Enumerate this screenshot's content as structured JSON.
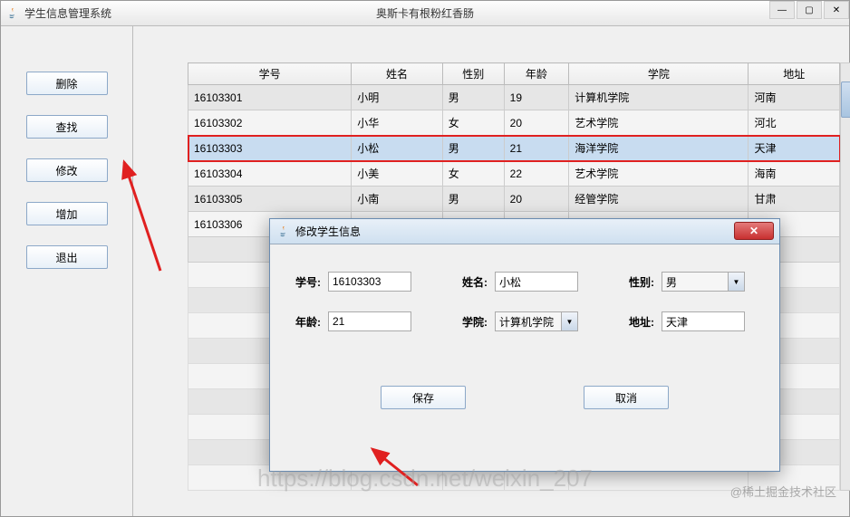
{
  "window": {
    "app_title": "学生信息管理系统",
    "center_title": "奥斯卡有根粉红香肠"
  },
  "sidebar": {
    "buttons": {
      "delete": "删除",
      "search": "查找",
      "modify": "修改",
      "add": "增加",
      "exit": "退出"
    }
  },
  "table": {
    "headers": [
      "学号",
      "姓名",
      "性别",
      "年龄",
      "学院",
      "地址"
    ],
    "rows": [
      {
        "id": "16103301",
        "name": "小明",
        "gender": "男",
        "age": "19",
        "college": "计算机学院",
        "addr": "河南"
      },
      {
        "id": "16103302",
        "name": "小华",
        "gender": "女",
        "age": "20",
        "college": "艺术学院",
        "addr": "河北"
      },
      {
        "id": "16103303",
        "name": "小松",
        "gender": "男",
        "age": "21",
        "college": "海洋学院",
        "addr": "天津",
        "selected": true
      },
      {
        "id": "16103304",
        "name": "小美",
        "gender": "女",
        "age": "22",
        "college": "艺术学院",
        "addr": "海南"
      },
      {
        "id": "16103305",
        "name": "小南",
        "gender": "男",
        "age": "20",
        "college": "经管学院",
        "addr": "甘肃"
      },
      {
        "id": "16103306",
        "name": "",
        "gender": "",
        "age": "",
        "college": "",
        "addr": ""
      },
      {
        "id": "",
        "name": "",
        "gender": "",
        "age": "",
        "college": "",
        "addr": ""
      }
    ]
  },
  "dialog": {
    "title": "修改学生信息",
    "labels": {
      "id": "学号:",
      "name": "姓名:",
      "gender": "性别:",
      "age": "年龄:",
      "college": "学院:",
      "addr": "地址:"
    },
    "values": {
      "id": "16103303",
      "name": "小松",
      "gender": "男",
      "age": "21",
      "college": "计算机学院",
      "addr": "天津"
    },
    "buttons": {
      "save": "保存",
      "cancel": "取消"
    }
  },
  "watermarks": {
    "main": "https://blog.csdn.net/weixin_207",
    "corner": "@稀土掘金技术社区"
  }
}
